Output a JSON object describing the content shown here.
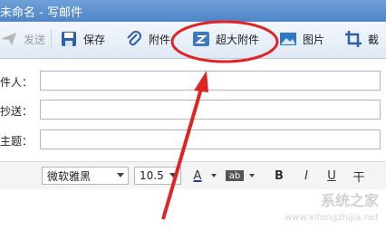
{
  "window": {
    "title": "未命名 - 写邮件"
  },
  "toolbar": {
    "send_label": "发送",
    "save_label": "保存",
    "attach_label": "附件",
    "big_attach_label": "超大附件",
    "image_label": "图片",
    "more_label": "截"
  },
  "form": {
    "to_label": "件人：",
    "cc_label": "抄送：",
    "subject_label": "主题：",
    "to_value": "",
    "cc_value": "",
    "subject_value": ""
  },
  "editor": {
    "font_family": "微软雅黑",
    "font_size": "10.5",
    "text_color_glyph": "A",
    "highlight_glyph": "ab",
    "bold_glyph": "B",
    "italic_glyph": "I",
    "underline_glyph": "U",
    "strike_glyph": "干"
  },
  "watermark": {
    "text": "系统之家",
    "url": "www.xitongzhijia.net"
  },
  "colors": {
    "title_bar": "#5b8fce",
    "annotation": "#e02424",
    "toolbar_bg": "#e6eef8"
  }
}
